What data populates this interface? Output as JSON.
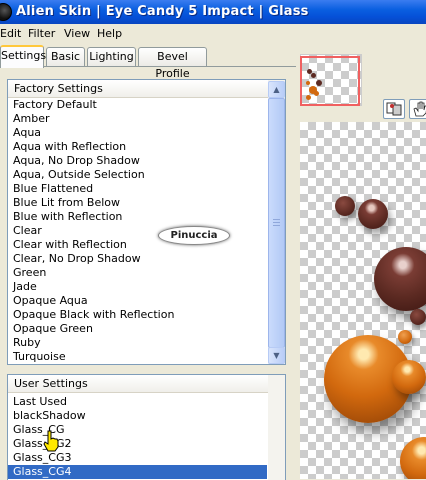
{
  "window": {
    "title": "Alien Skin  |  Eye Candy 5 Impact  |  Glass"
  },
  "menu": {
    "items": [
      "Edit",
      "Filter",
      "View",
      "Help"
    ]
  },
  "tabs": [
    "Settings",
    "Basic",
    "Lighting",
    "Bevel Profile"
  ],
  "active_tab": "Settings",
  "factory_settings": {
    "header": "Factory Settings",
    "items": [
      "Factory Default",
      "Amber",
      "Aqua",
      "Aqua with Reflection",
      "Aqua, No Drop Shadow",
      "Aqua, Outside Selection",
      "Blue Flattened",
      "Blue Lit from Below",
      "Blue with Reflection",
      "Clear",
      "Clear with Reflection",
      "Clear, No Drop Shadow",
      "Green",
      "Jade",
      "Opaque Aqua",
      "Opaque Black with Reflection",
      "Opaque Green",
      "Ruby",
      "Turquoise"
    ]
  },
  "user_settings": {
    "header": "User Settings",
    "items": [
      "Last Used",
      "blackShadow",
      "Glass_CG",
      "Glass_CG2",
      "Glass_CG3",
      "Glass_CG4"
    ],
    "selected": "Glass_CG4"
  },
  "watermark": "Pinuccia",
  "icons": {
    "app": "alien-skin-icon",
    "scroll_up": "scroll-up-arrow-icon",
    "scroll_down": "scroll-down-arrow-icon",
    "compare": "compare-icon",
    "hand": "hand-tool-icon",
    "cursor": "hand-pointer-icon"
  },
  "colors": {
    "titlebar": "#0A5FE0",
    "selection": "#316AC5",
    "preview_frame": "#F06060",
    "ball_orange": "#D2690E",
    "ball_brown": "#5C2A22"
  }
}
